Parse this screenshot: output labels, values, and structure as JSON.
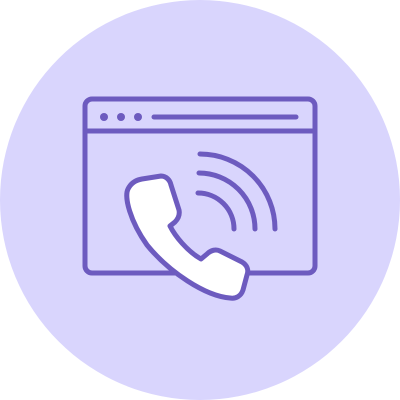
{
  "icon": {
    "name": "web-call-icon",
    "background_color": "#d9d5fd",
    "stroke_color": "#6d5bbf"
  }
}
